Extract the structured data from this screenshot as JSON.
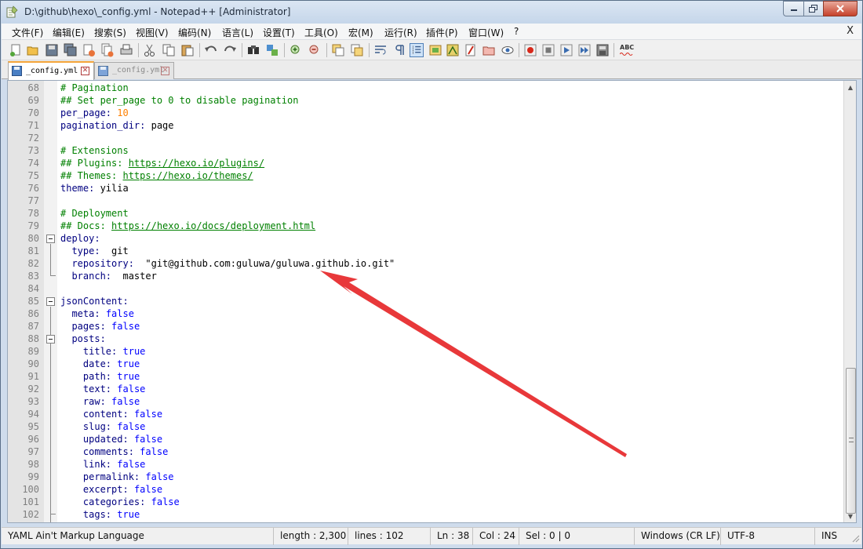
{
  "window": {
    "title": "D:\\github\\hexo\\_config.yml - Notepad++ [Administrator]"
  },
  "menu": {
    "items": [
      "文件(F)",
      "编辑(E)",
      "搜索(S)",
      "视图(V)",
      "编码(N)",
      "语言(L)",
      "设置(T)",
      "工具(O)",
      "宏(M)",
      "运行(R)",
      "插件(P)",
      "窗口(W)",
      "?"
    ],
    "close_label": "X"
  },
  "toolbar": {
    "icons": [
      "new-file-icon",
      "open-file-icon",
      "save-icon",
      "save-all-icon",
      "close-icon",
      "close-all-icon",
      "print-icon",
      "cut-icon",
      "copy-icon",
      "paste-icon",
      "undo-icon",
      "redo-icon",
      "find-icon",
      "replace-icon",
      "zoom-in-icon",
      "zoom-out-icon",
      "sync-vertical-icon",
      "sync-horizontal-icon",
      "word-wrap-icon",
      "show-all-chars-icon",
      "indent-guide-icon",
      "udl-icon",
      "doc-map-icon",
      "function-list-icon",
      "folder-workspace-icon",
      "monitoring-icon",
      "record-macro-icon",
      "stop-macro-icon",
      "play-macro-icon",
      "run-macro-multiple-icon",
      "save-macro-icon",
      "spellcheck-icon"
    ],
    "spellcheck_label": "ABC"
  },
  "tabs": [
    {
      "label": "_config.yml",
      "active": true
    },
    {
      "label": "_config.yml",
      "active": false
    }
  ],
  "editor": {
    "lines": [
      {
        "n": "68",
        "segs": [
          [
            "comment",
            "# Pagination"
          ]
        ]
      },
      {
        "n": "69",
        "segs": [
          [
            "comment",
            "## Set per_page to 0 to disable pagination"
          ]
        ]
      },
      {
        "n": "70",
        "segs": [
          [
            "key",
            "per_page:"
          ],
          [
            "plain",
            " "
          ],
          [
            "num",
            "10"
          ]
        ]
      },
      {
        "n": "71",
        "segs": [
          [
            "key",
            "pagination_dir:"
          ],
          [
            "plain",
            " page"
          ]
        ]
      },
      {
        "n": "72",
        "segs": []
      },
      {
        "n": "73",
        "segs": [
          [
            "comment",
            "# Extensions"
          ]
        ]
      },
      {
        "n": "74",
        "segs": [
          [
            "comment",
            "## Plugins: "
          ],
          [
            "url",
            "https://hexo.io/plugins/"
          ]
        ]
      },
      {
        "n": "75",
        "segs": [
          [
            "comment",
            "## Themes: "
          ],
          [
            "url",
            "https://hexo.io/themes/"
          ]
        ]
      },
      {
        "n": "76",
        "segs": [
          [
            "key",
            "theme:"
          ],
          [
            "plain",
            " yilia"
          ]
        ]
      },
      {
        "n": "77",
        "segs": []
      },
      {
        "n": "78",
        "segs": [
          [
            "comment",
            "# Deployment"
          ]
        ]
      },
      {
        "n": "79",
        "segs": [
          [
            "comment",
            "## Docs: "
          ],
          [
            "url",
            "https://hexo.io/docs/deployment.html"
          ]
        ]
      },
      {
        "n": "80",
        "segs": [
          [
            "key",
            "deploy:"
          ]
        ]
      },
      {
        "n": "81",
        "segs": [
          [
            "plain",
            "  "
          ],
          [
            "key",
            "type:"
          ],
          [
            "plain",
            "  git"
          ]
        ]
      },
      {
        "n": "82",
        "segs": [
          [
            "plain",
            "  "
          ],
          [
            "key",
            "repository:"
          ],
          [
            "plain",
            "  \"git@github.com:guluwa/guluwa.github.io.git\""
          ]
        ]
      },
      {
        "n": "83",
        "segs": [
          [
            "plain",
            "  "
          ],
          [
            "key",
            "branch:"
          ],
          [
            "plain",
            "  master"
          ]
        ]
      },
      {
        "n": "84",
        "segs": []
      },
      {
        "n": "85",
        "segs": [
          [
            "key",
            "jsonContent:"
          ]
        ]
      },
      {
        "n": "86",
        "segs": [
          [
            "plain",
            "  "
          ],
          [
            "key",
            "meta:"
          ],
          [
            "plain",
            " "
          ],
          [
            "bool",
            "false"
          ]
        ]
      },
      {
        "n": "87",
        "segs": [
          [
            "plain",
            "  "
          ],
          [
            "key",
            "pages:"
          ],
          [
            "plain",
            " "
          ],
          [
            "bool",
            "false"
          ]
        ]
      },
      {
        "n": "88",
        "segs": [
          [
            "plain",
            "  "
          ],
          [
            "key",
            "posts:"
          ]
        ]
      },
      {
        "n": "89",
        "segs": [
          [
            "plain",
            "    "
          ],
          [
            "key",
            "title:"
          ],
          [
            "plain",
            " "
          ],
          [
            "bool",
            "true"
          ]
        ]
      },
      {
        "n": "90",
        "segs": [
          [
            "plain",
            "    "
          ],
          [
            "key",
            "date:"
          ],
          [
            "plain",
            " "
          ],
          [
            "bool",
            "true"
          ]
        ]
      },
      {
        "n": "91",
        "segs": [
          [
            "plain",
            "    "
          ],
          [
            "key",
            "path:"
          ],
          [
            "plain",
            " "
          ],
          [
            "bool",
            "true"
          ]
        ]
      },
      {
        "n": "92",
        "segs": [
          [
            "plain",
            "    "
          ],
          [
            "key",
            "text:"
          ],
          [
            "plain",
            " "
          ],
          [
            "bool",
            "false"
          ]
        ]
      },
      {
        "n": "93",
        "segs": [
          [
            "plain",
            "    "
          ],
          [
            "key",
            "raw:"
          ],
          [
            "plain",
            " "
          ],
          [
            "bool",
            "false"
          ]
        ]
      },
      {
        "n": "94",
        "segs": [
          [
            "plain",
            "    "
          ],
          [
            "key",
            "content:"
          ],
          [
            "plain",
            " "
          ],
          [
            "bool",
            "false"
          ]
        ]
      },
      {
        "n": "95",
        "segs": [
          [
            "plain",
            "    "
          ],
          [
            "key",
            "slug:"
          ],
          [
            "plain",
            " "
          ],
          [
            "bool",
            "false"
          ]
        ]
      },
      {
        "n": "96",
        "segs": [
          [
            "plain",
            "    "
          ],
          [
            "key",
            "updated:"
          ],
          [
            "plain",
            " "
          ],
          [
            "bool",
            "false"
          ]
        ]
      },
      {
        "n": "97",
        "segs": [
          [
            "plain",
            "    "
          ],
          [
            "key",
            "comments:"
          ],
          [
            "plain",
            " "
          ],
          [
            "bool",
            "false"
          ]
        ]
      },
      {
        "n": "98",
        "segs": [
          [
            "plain",
            "    "
          ],
          [
            "key",
            "link:"
          ],
          [
            "plain",
            " "
          ],
          [
            "bool",
            "false"
          ]
        ]
      },
      {
        "n": "99",
        "segs": [
          [
            "plain",
            "    "
          ],
          [
            "key",
            "permalink:"
          ],
          [
            "plain",
            " "
          ],
          [
            "bool",
            "false"
          ]
        ]
      },
      {
        "n": "100",
        "segs": [
          [
            "plain",
            "    "
          ],
          [
            "key",
            "excerpt:"
          ],
          [
            "plain",
            " "
          ],
          [
            "bool",
            "false"
          ]
        ]
      },
      {
        "n": "101",
        "segs": [
          [
            "plain",
            "    "
          ],
          [
            "key",
            "categories:"
          ],
          [
            "plain",
            " "
          ],
          [
            "bool",
            "false"
          ]
        ]
      },
      {
        "n": "102",
        "segs": [
          [
            "plain",
            "    "
          ],
          [
            "key",
            "tags:"
          ],
          [
            "plain",
            " "
          ],
          [
            "bool",
            "true"
          ]
        ]
      }
    ],
    "annotation_color": "#e8383a"
  },
  "status": {
    "language": "YAML Ain't Markup Language",
    "length": "length : 2,300",
    "lines": "lines : 102",
    "ln": "Ln : 38",
    "col": "Col : 24",
    "sel": "Sel : 0 | 0",
    "eol": "Windows (CR LF)",
    "encoding": "UTF-8",
    "mode": "INS"
  },
  "colors": {
    "comment": "#008000",
    "key": "#000080",
    "number": "#ff8000",
    "boolean": "#0000ff"
  }
}
